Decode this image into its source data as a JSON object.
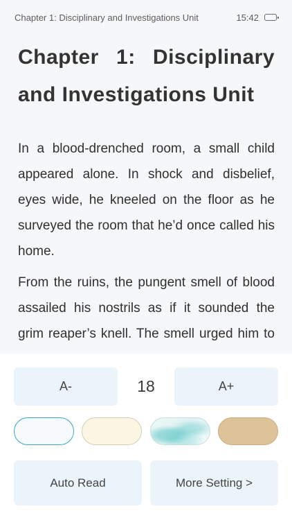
{
  "header": {
    "chapter_label": "Chapter 1: Disciplinary and Investigations Unit",
    "time": "15:42"
  },
  "reader": {
    "title": "Chapter 1: Disciplinary and Investigations Unit",
    "paragraphs": [
      "In a blood-drenched room, a small child appeared alone. In shock and disbelief, eyes wide, he kneeled on the floor as he surveyed the room that he’d once called his home.",
      "From the ruins, the pungent smell of blood assailed his nostrils as if it sounded the grim reaper’s knell. The smell urged him to quickly turn back, flee to the door, and"
    ]
  },
  "settings": {
    "font_decrease_label": "A-",
    "font_size": "18",
    "font_increase_label": "A+",
    "themes": [
      {
        "name": "white",
        "color": "#f7fafc",
        "selected": true
      },
      {
        "name": "cream",
        "color": "#fbf6e4",
        "selected": false
      },
      {
        "name": "sea",
        "color": "#dff1f1",
        "selected": false
      },
      {
        "name": "tan",
        "color": "#dcc399",
        "selected": false
      }
    ],
    "auto_read_label": "Auto Read",
    "more_setting_label": "More Setting >"
  },
  "colors": {
    "page_bg": "#f6f7f9",
    "button_bg": "#ecf4fb",
    "selected_border": "#3aa6c9"
  }
}
